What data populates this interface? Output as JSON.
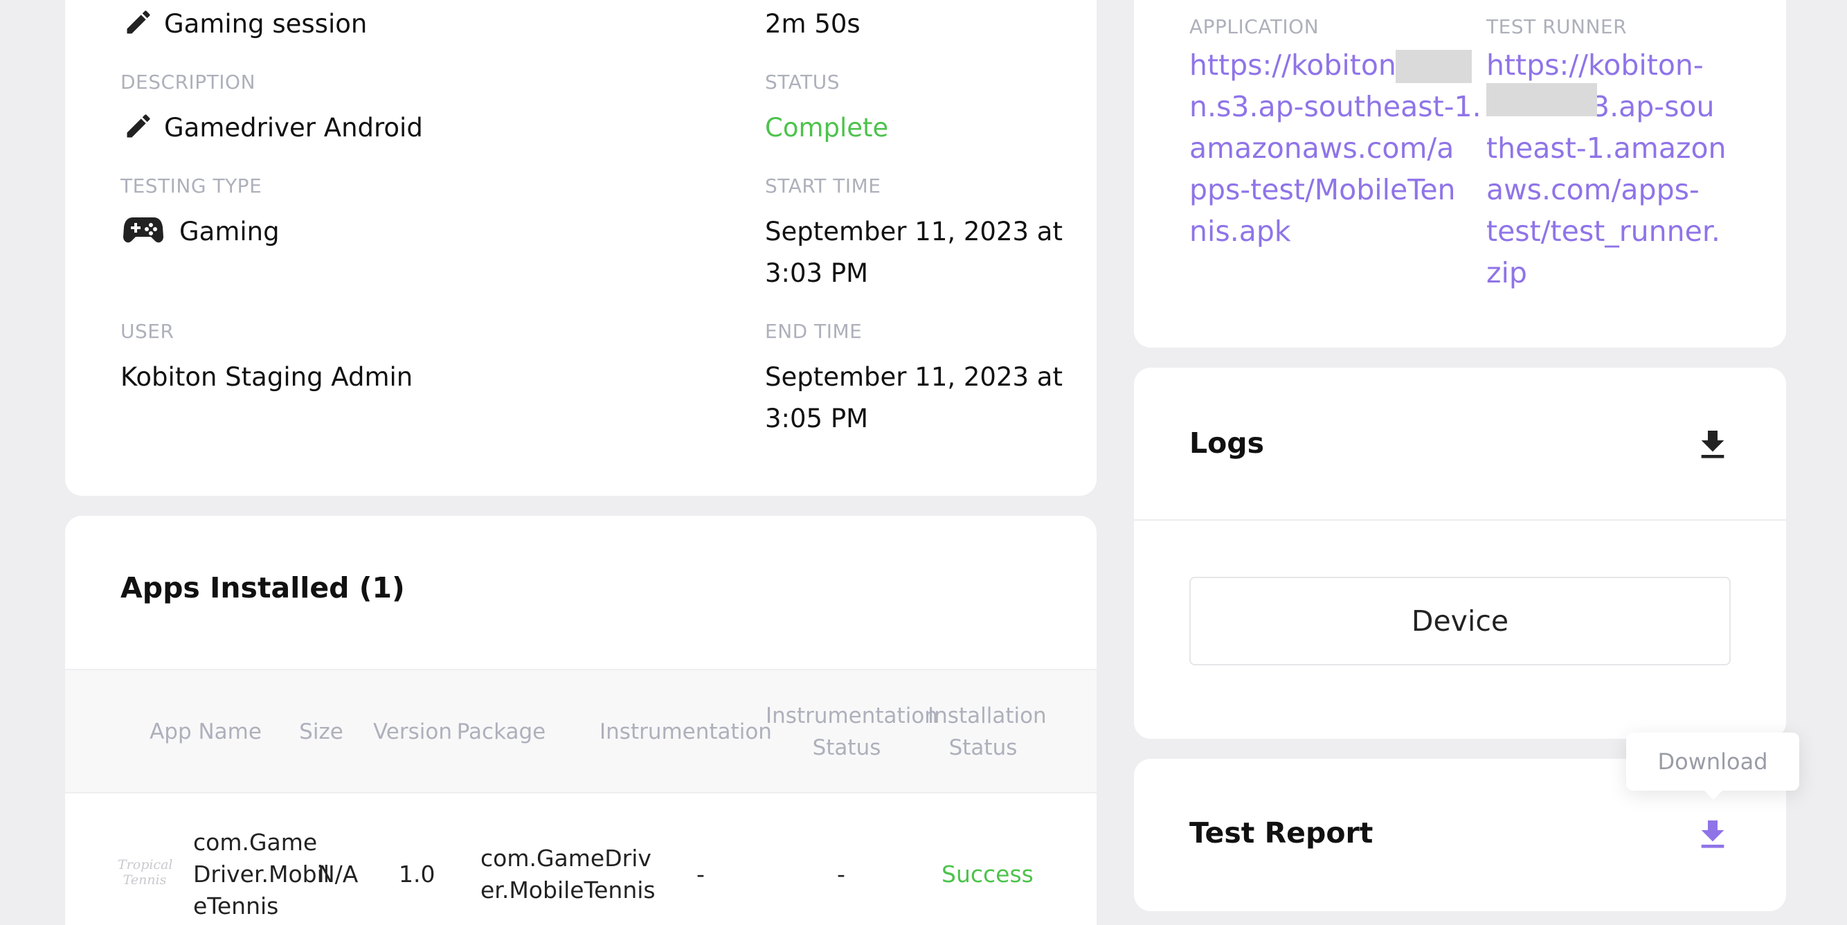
{
  "session": {
    "name": "Gaming session",
    "duration": "2m 50s",
    "description_label": "DESCRIPTION",
    "description": "Gamedriver Android",
    "status_label": "STATUS",
    "status": "Complete",
    "testing_type_label": "TESTING TYPE",
    "testing_type": "Gaming",
    "start_time_label": "START TIME",
    "start_time_line1": "September 11, 2023 at",
    "start_time_line2": "3:03 PM",
    "user_label": "USER",
    "user": "Kobiton Staging Admin",
    "end_time_label": "END TIME",
    "end_time_line1": "September 11, 2023 at",
    "end_time_line2": "3:05 PM"
  },
  "files": {
    "application_label": "APPLICATION",
    "application_lines": [
      "https://kobiton-",
      "n.s3.ap-southeast-1.",
      "amazonaws.com/a",
      "pps-test/MobileTen",
      "nis.apk"
    ],
    "test_runner_label": "TEST RUNNER",
    "test_runner_lines": [
      "https://kobiton-",
      "3.ap-sou",
      "theast-1.amazon",
      "aws.com/apps-",
      "test/test_runner.",
      "zip"
    ]
  },
  "logs": {
    "title": "Logs",
    "device_button": "Device"
  },
  "apps": {
    "title": "Apps Installed (1)",
    "columns": {
      "app_name": "App Name",
      "size": "Size",
      "version": "Version",
      "package": "Package",
      "instrumentation": "Instrumentation",
      "instrumentation_status_l1": "Instrumentation",
      "instrumentation_status_l2": "Status",
      "installation_status_l1": "Installation",
      "installation_status_l2": "Status"
    },
    "rows": [
      {
        "logo_text_l1": "Tropical",
        "logo_text_l2": "Tennis",
        "name_lines": [
          "com.Game",
          "Driver.Mobil",
          "eTennis"
        ],
        "size": "N/A",
        "version": "1.0",
        "package_lines": [
          "com.GameDriv",
          "er.MobileTennis"
        ],
        "instrumentation": "-",
        "instrumentation_status": "-",
        "installation_status": "Success"
      }
    ]
  },
  "report": {
    "title": "Test Report",
    "tooltip": "Download"
  },
  "colors": {
    "accent": "#8f74e8",
    "success": "#4cc34c",
    "muted": "#aeb0bb"
  }
}
